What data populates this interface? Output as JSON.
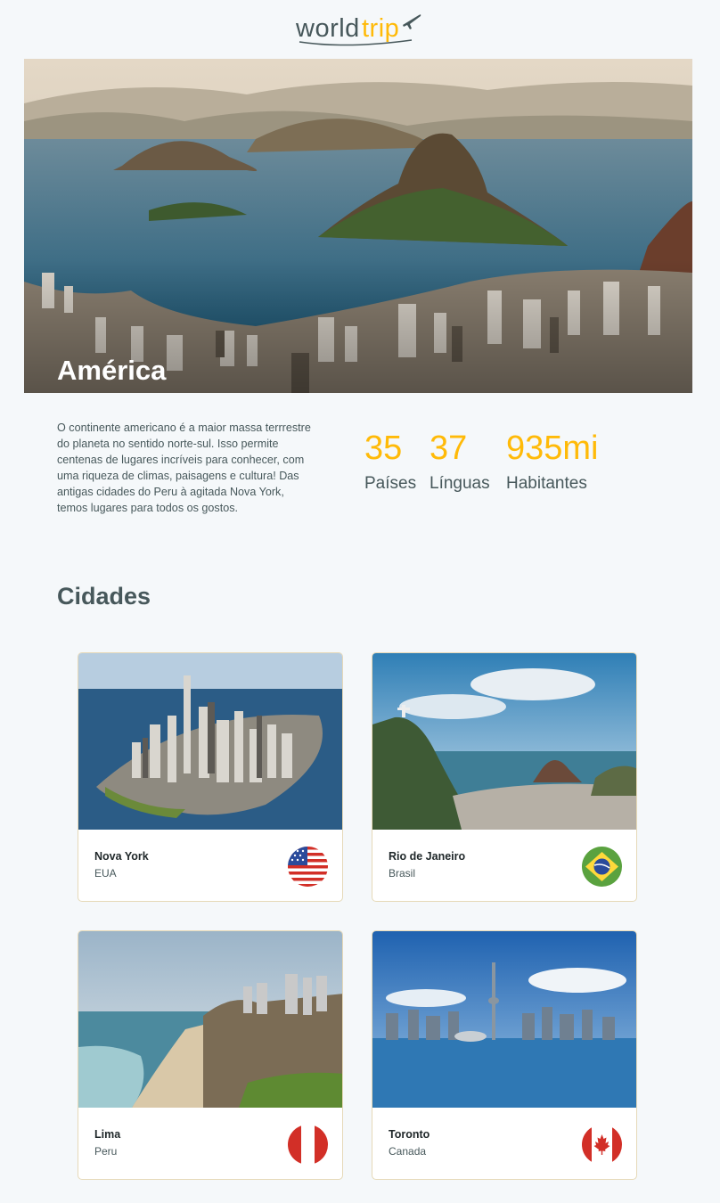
{
  "header": {
    "logo_part1": "world",
    "logo_part2": "trip",
    "logo_icon": "airplane-icon"
  },
  "hero": {
    "title": "América"
  },
  "intro": {
    "text": "O continente americano é a maior massa terrrestre do planeta no sentido norte-sul. Isso permite centenas de lugares incríveis para conhecer, com uma riqueza de climas, paisagens e cultura! Das antigas cidades do Peru à agitada Nova York, temos lugares para todos os gostos."
  },
  "stats": [
    {
      "value": "35",
      "label": "Países"
    },
    {
      "value": "37",
      "label": "Línguas"
    },
    {
      "value": "935mi",
      "label": "Habitantes"
    }
  ],
  "cities_section": {
    "title": "Cidades"
  },
  "cities": [
    {
      "name": "Nova York",
      "country": "EUA",
      "flag": "usa-flag-icon"
    },
    {
      "name": "Rio de Janeiro",
      "country": "Brasil",
      "flag": "brazil-flag-icon"
    },
    {
      "name": "Lima",
      "country": "Peru",
      "flag": "peru-flag-icon"
    },
    {
      "name": "Toronto",
      "country": "Canada",
      "flag": "canada-flag-icon"
    }
  ],
  "colors": {
    "accent": "#ffba08",
    "text": "#47585b",
    "background": "#f5f8fa"
  }
}
